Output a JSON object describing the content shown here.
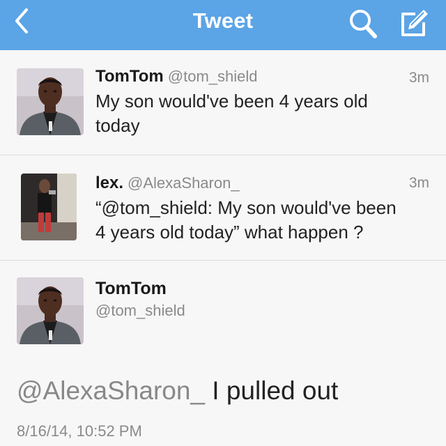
{
  "navbar": {
    "title": "Tweet",
    "back_icon": "chevron-left-icon",
    "search_icon": "search-icon",
    "compose_icon": "compose-icon",
    "background": "#5ba4e6"
  },
  "tweets": [
    {
      "name": "TomTom",
      "handle": "@tom_shield",
      "time": "3m",
      "text_line1": "My son would've been 4 years old",
      "text_line2": "today"
    },
    {
      "name": "lex.",
      "handle": "@AlexaSharon_",
      "time": "3m",
      "text_line1": "“@tom_shield: My son would've been",
      "text_line2": "4 years old today” what happen ?"
    }
  ],
  "detail": {
    "name": "TomTom",
    "handle": "@tom_shield",
    "mention": "@AlexaSharon_",
    "text": " I pulled out",
    "timestamp": "8/16/14, 10:52 PM"
  }
}
